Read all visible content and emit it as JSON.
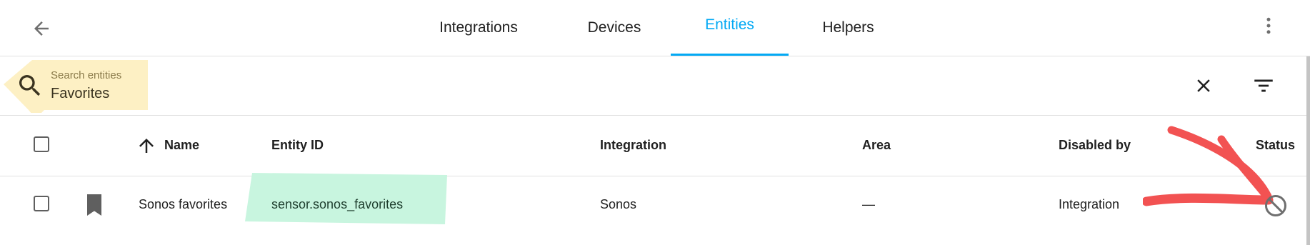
{
  "nav": {
    "tabs": [
      {
        "label": "Integrations",
        "active": false
      },
      {
        "label": "Devices",
        "active": false
      },
      {
        "label": "Entities",
        "active": true
      },
      {
        "label": "Helpers",
        "active": false
      }
    ],
    "back_icon": "arrow-left-icon",
    "menu_icon": "dots-vertical-icon"
  },
  "search": {
    "label": "Search entities",
    "value": "Favorites",
    "icon": "search-icon",
    "clear_icon": "close-icon",
    "filter_icon": "filter-icon"
  },
  "table": {
    "columns": {
      "name": "Name",
      "entity_id": "Entity ID",
      "integration": "Integration",
      "area": "Area",
      "disabled_by": "Disabled by",
      "status": "Status"
    },
    "sort_icon": "arrow-up-icon",
    "rows": [
      {
        "icon": "bookmark-icon",
        "name": "Sonos favorites",
        "entity_id": "sensor.sonos_favorites",
        "integration": "Sonos",
        "area": "—",
        "disabled_by": "Integration",
        "status_icon": "cancel-icon"
      }
    ]
  },
  "colors": {
    "accent": "#03a9f4",
    "search_highlight": "#fdf0c4",
    "entity_highlight": "#c8f5df",
    "annotation_arrow": "#f25252"
  }
}
